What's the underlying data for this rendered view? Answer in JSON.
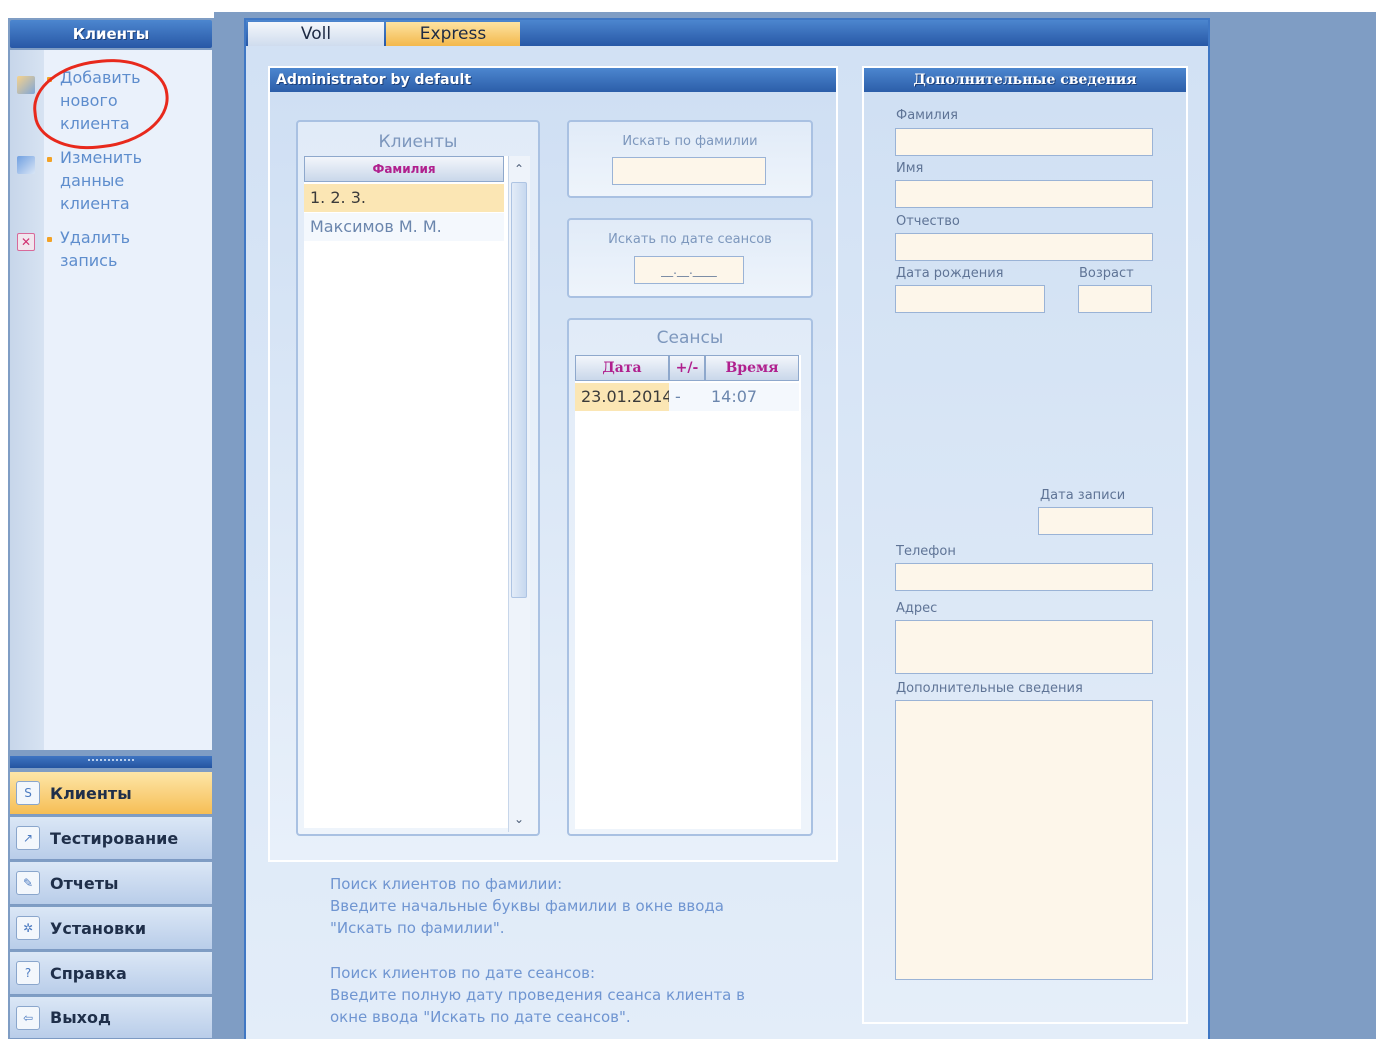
{
  "sidebar": {
    "header": "Клиенты",
    "tasks": [
      {
        "label": "Добавить нового клиента",
        "icon": "add-user-icon"
      },
      {
        "label": "Изменить данные клиента",
        "icon": "edit-user-icon"
      },
      {
        "label": "Удалить запись",
        "icon": "delete-icon"
      }
    ],
    "nav": [
      {
        "label": "Клиенты",
        "icon": "clients-icon",
        "active": true
      },
      {
        "label": "Тестирование",
        "icon": "chart-icon"
      },
      {
        "label": "Отчеты",
        "icon": "report-icon"
      },
      {
        "label": "Установки",
        "icon": "settings-icon"
      },
      {
        "label": "Справка",
        "icon": "help-icon"
      },
      {
        "label": "Выход",
        "icon": "exit-icon"
      }
    ]
  },
  "tabs": [
    {
      "label": "Voll"
    },
    {
      "label": "Express",
      "active": true
    }
  ],
  "admin": {
    "header": "Administrator by default",
    "clients": {
      "title": "Клиенты",
      "column": "Фамилия",
      "rows": [
        "1. 2. 3.",
        "Максимов  М. М."
      ]
    },
    "search_name": {
      "title": "Искать по фамилии",
      "value": ""
    },
    "search_date": {
      "title": "Искать по дате сеансов",
      "value": "__.__.____"
    },
    "sessions": {
      "title": "Сеансы",
      "columns": [
        "Дата",
        "+/-",
        "Время"
      ],
      "rows": [
        {
          "date": "23.01.2014",
          "sign": "-",
          "time": "14:07"
        }
      ]
    },
    "help": [
      "Поиск клиентов по фамилии:",
      "Введите начальные буквы фамилии в окне ввода",
      "\"Искать по фамилии\".",
      "Поиск клиентов по дате сеансов:",
      "Введите полную дату проведения сеанса клиента в",
      "окне ввода \"Искать по дате сеансов\"."
    ]
  },
  "info": {
    "header": "Дополнительные сведения",
    "fields": {
      "surname": "Фамилия",
      "name": "Имя",
      "patronymic": "Отчество",
      "birth_date": "Дата рождения",
      "age": "Возраст",
      "record_date": "Дата записи",
      "phone": "Телефон",
      "address": "Адрес",
      "extra": "Дополнительные сведения"
    }
  },
  "colors": {
    "header_blue": "#2858a6",
    "accent_orange": "#f3b84c",
    "field_bg": "#fdf6ea",
    "annotation_red": "#e8291c"
  }
}
